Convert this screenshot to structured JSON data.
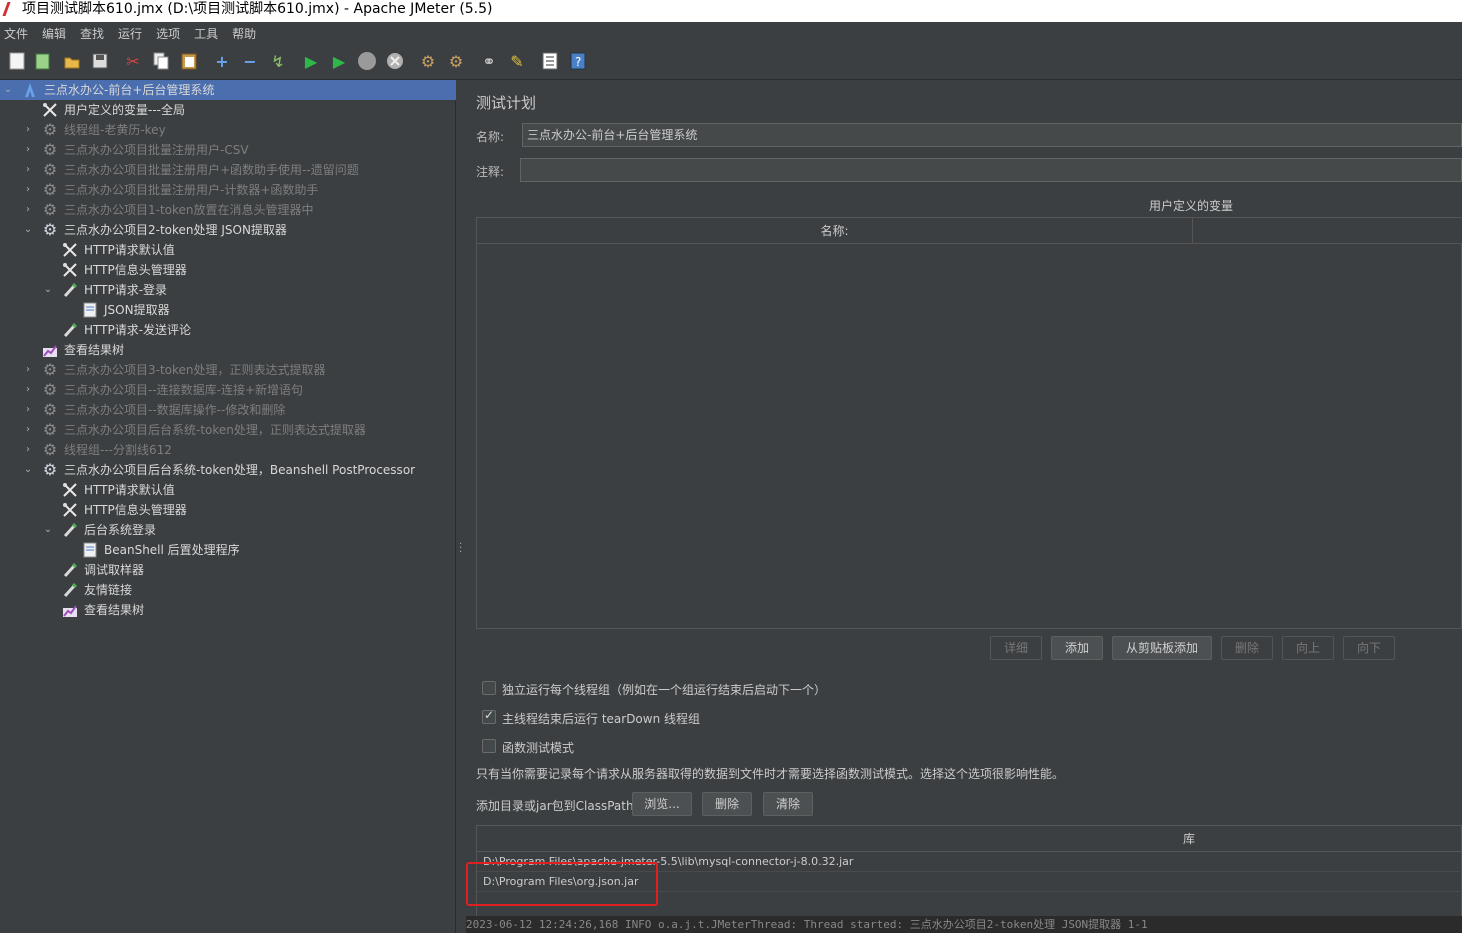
{
  "window": {
    "title": "项目测试脚本610.jmx (D:\\项目测试脚本610.jmx) - Apache JMeter (5.5)"
  },
  "menu": [
    "文件",
    "编辑",
    "查找",
    "运行",
    "选项",
    "工具",
    "帮助"
  ],
  "toolbar_icons": [
    "new-icon",
    "templates-icon",
    "open-icon",
    "save-icon",
    "cut-icon",
    "copy-icon",
    "paste-icon",
    "expand-icon",
    "collapse-icon",
    "toggle-icon",
    "start-icon",
    "start-no-pause-icon",
    "stop-icon",
    "shutdown-icon",
    "clear-icon",
    "clear-all-icon",
    "search-icon",
    "reset-search-icon",
    "function-helper-icon",
    "help-icon"
  ],
  "tree": [
    {
      "label": "三点水办公-前台+后台管理系统",
      "depth": 0,
      "icon": "test-plan-icon",
      "state": "expanded",
      "selected": true,
      "enabled": true
    },
    {
      "label": "用户定义的变量---全局",
      "depth": 1,
      "icon": "config-icon",
      "state": "leaf",
      "enabled": true
    },
    {
      "label": "线程组-老黄历-key",
      "depth": 1,
      "icon": "thread-group-icon",
      "state": "collapsed",
      "enabled": false
    },
    {
      "label": "三点水办公项目批量注册用户-CSV",
      "depth": 1,
      "icon": "thread-group-icon",
      "state": "collapsed",
      "enabled": false
    },
    {
      "label": "三点水办公项目批量注册用户+函数助手使用--遗留问题",
      "depth": 1,
      "icon": "thread-group-icon",
      "state": "collapsed",
      "enabled": false
    },
    {
      "label": "三点水办公项目批量注册用户-计数器+函数助手",
      "depth": 1,
      "icon": "thread-group-icon",
      "state": "collapsed",
      "enabled": false
    },
    {
      "label": "三点水办公项目1-token放置在消息头管理器中",
      "depth": 1,
      "icon": "thread-group-icon",
      "state": "collapsed",
      "enabled": false
    },
    {
      "label": "三点水办公项目2-token处理  JSON提取器",
      "depth": 1,
      "icon": "thread-group-icon",
      "state": "expanded",
      "enabled": true
    },
    {
      "label": "HTTP请求默认值",
      "depth": 2,
      "icon": "config-icon",
      "state": "leaf",
      "enabled": true
    },
    {
      "label": "HTTP信息头管理器",
      "depth": 2,
      "icon": "config-icon",
      "state": "leaf",
      "enabled": true
    },
    {
      "label": "HTTP请求-登录",
      "depth": 2,
      "icon": "sampler-icon",
      "state": "expanded",
      "enabled": true
    },
    {
      "label": "JSON提取器",
      "depth": 3,
      "icon": "post-processor-icon",
      "state": "leaf",
      "enabled": true
    },
    {
      "label": "HTTP请求-发送评论",
      "depth": 2,
      "icon": "sampler-icon",
      "state": "leaf",
      "enabled": true
    },
    {
      "label": "查看结果树",
      "depth": 1,
      "icon": "listener-icon",
      "state": "leaf",
      "enabled": true
    },
    {
      "label": "三点水办公项目3-token处理，正则表达式提取器",
      "depth": 1,
      "icon": "thread-group-icon",
      "state": "collapsed",
      "enabled": false
    },
    {
      "label": "三点水办公项目--连接数据库-连接+新增语句",
      "depth": 1,
      "icon": "thread-group-icon",
      "state": "collapsed",
      "enabled": false
    },
    {
      "label": "三点水办公项目--数据库操作--修改和删除",
      "depth": 1,
      "icon": "thread-group-icon",
      "state": "collapsed",
      "enabled": false
    },
    {
      "label": "三点水办公项目后台系统-token处理，正则表达式提取器",
      "depth": 1,
      "icon": "thread-group-icon",
      "state": "collapsed",
      "enabled": false
    },
    {
      "label": "线程组---分割线612",
      "depth": 1,
      "icon": "thread-group-icon",
      "state": "collapsed",
      "enabled": false
    },
    {
      "label": "三点水办公项目后台系统-token处理，Beanshell PostProcessor",
      "depth": 1,
      "icon": "thread-group-icon",
      "state": "expanded",
      "enabled": true
    },
    {
      "label": "HTTP请求默认值",
      "depth": 2,
      "icon": "config-icon",
      "state": "leaf",
      "enabled": true
    },
    {
      "label": "HTTP信息头管理器",
      "depth": 2,
      "icon": "config-icon",
      "state": "leaf",
      "enabled": true
    },
    {
      "label": "后台系统登录",
      "depth": 2,
      "icon": "sampler-icon",
      "state": "expanded",
      "enabled": true
    },
    {
      "label": "BeanShell 后置处理程序",
      "depth": 3,
      "icon": "post-processor-icon",
      "state": "leaf",
      "enabled": true
    },
    {
      "label": "调试取样器",
      "depth": 2,
      "icon": "sampler-icon",
      "state": "leaf",
      "enabled": true
    },
    {
      "label": "友情链接",
      "depth": 2,
      "icon": "sampler-icon",
      "state": "leaf",
      "enabled": true
    },
    {
      "label": "查看结果树",
      "depth": 2,
      "icon": "listener-icon",
      "state": "leaf",
      "enabled": true
    }
  ],
  "panel": {
    "title": "测试计划",
    "name_label": "名称:",
    "name_value": "三点水办公-前台+后台管理系统",
    "comment_label": "注释:",
    "comment_value": "",
    "udv_title": "用户定义的变量",
    "udv_column": "名称:",
    "buttons": {
      "detail": "详细",
      "add": "添加",
      "add_clipboard": "从剪贴板添加",
      "delete": "删除",
      "up": "向上",
      "down": "向下"
    },
    "checkboxes": [
      {
        "label": "独立运行每个线程组（例如在一个组运行结束后启动下一个）",
        "checked": false
      },
      {
        "label": "主线程结束后运行 tearDown 线程组",
        "checked": true
      },
      {
        "label": "函数测试模式",
        "checked": false
      }
    ],
    "functional_note": "只有当你需要记录每个请求从服务器取得的数据到文件时才需要选择函数测试模式。选择这个选项很影响性能。",
    "classpath_label": "添加目录或jar包到ClassPath",
    "classpath_buttons": {
      "browse": "浏览...",
      "delete": "删除",
      "clear": "清除"
    },
    "lib_header": "库",
    "libs": [
      "D:\\Program Files\\apache-jmeter-5.5\\lib\\mysql-connector-j-8.0.32.jar",
      "D:\\Program Files\\org.json.jar"
    ],
    "log_line": "2023-06-12 12:24:26,168 INFO o.a.j.t.JMeterThread: Thread started: 三点水办公项目2-token处理  JSON提取器 1-1"
  },
  "colors": {
    "background": "#3c3f41",
    "selection": "#4b6eaf",
    "highlight": "#e02020"
  }
}
